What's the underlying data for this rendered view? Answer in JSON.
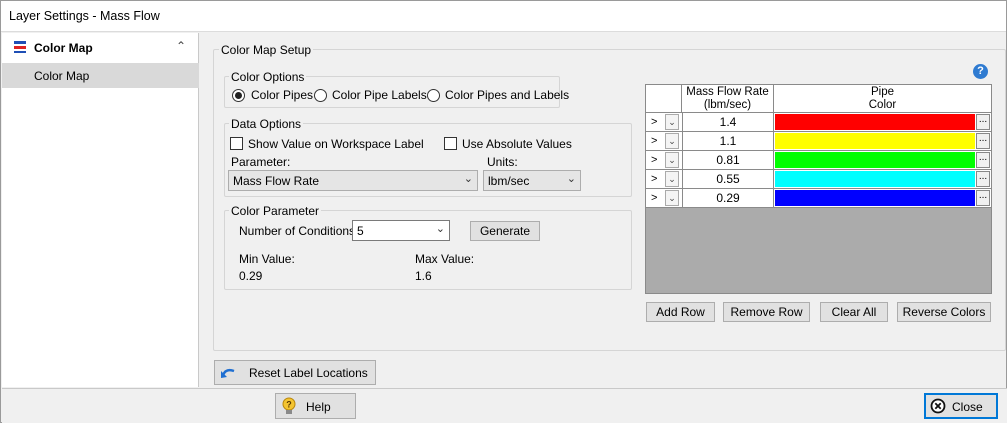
{
  "window": {
    "title": "Layer Settings - Mass Flow"
  },
  "sidebar": {
    "header": {
      "icon": "color-map-icon",
      "label": "Color Map",
      "collapse_icon": "chevron-up-icon"
    },
    "items": [
      {
        "label": "Color Map"
      }
    ]
  },
  "setup": {
    "title": "Color Map Setup",
    "color_options": {
      "legend": "Color Options",
      "radios": [
        {
          "label": "Color Pipes",
          "selected": true
        },
        {
          "label": "Color Pipe Labels",
          "selected": false
        },
        {
          "label": "Color Pipes and Labels",
          "selected": false
        }
      ]
    },
    "data_options": {
      "legend": "Data Options",
      "show_value_label": "Show Value on Workspace Label",
      "show_value_checked": false,
      "absolute_label": "Use Absolute Values",
      "absolute_checked": false,
      "parameter_label": "Parameter:",
      "parameter_value": "Mass Flow Rate",
      "units_label": "Units:",
      "units_value": "lbm/sec"
    },
    "color_parameter": {
      "legend": "Color Parameter",
      "conditions_label": "Number of Conditions:",
      "conditions_value": "5",
      "generate_label": "Generate",
      "min_label": "Min Value:",
      "min_value": "0.29",
      "max_label": "Max Value:",
      "max_value": "1.6"
    },
    "help_icon": "question-icon"
  },
  "grid": {
    "header_value_line1": "Mass Flow Rate",
    "header_value_line2": "(lbm/sec)",
    "header_color_line1": "Pipe",
    "header_color_line2": "Color",
    "rows": [
      {
        "selector": ">",
        "value": "1.4",
        "color": "#ff0000",
        "ellipsis": "..."
      },
      {
        "selector": ">",
        "value": "1.1",
        "color": "#ffff00",
        "ellipsis": "..."
      },
      {
        "selector": ">",
        "value": "0.81",
        "color": "#00ff00",
        "ellipsis": "..."
      },
      {
        "selector": ">",
        "value": "0.55",
        "color": "#00ffff",
        "ellipsis": "..."
      },
      {
        "selector": ">",
        "value": "0.29",
        "color": "#0000ff",
        "ellipsis": "..."
      }
    ],
    "buttons": {
      "add_row": "Add Row",
      "remove_row": "Remove Row",
      "clear_all": "Clear All",
      "reverse_colors": "Reverse Colors"
    }
  },
  "reset_button": {
    "label": "Reset Label Locations",
    "icon": "undo-arrow-icon"
  },
  "footer": {
    "help": {
      "label": "Help",
      "icon": "help-bulb-icon"
    },
    "close": {
      "label": "Close",
      "icon": "close-circle-icon"
    }
  },
  "colors": {
    "accent": "#0078d7",
    "help_blue": "#2f7bd1",
    "grid_empty": "#ababab"
  }
}
